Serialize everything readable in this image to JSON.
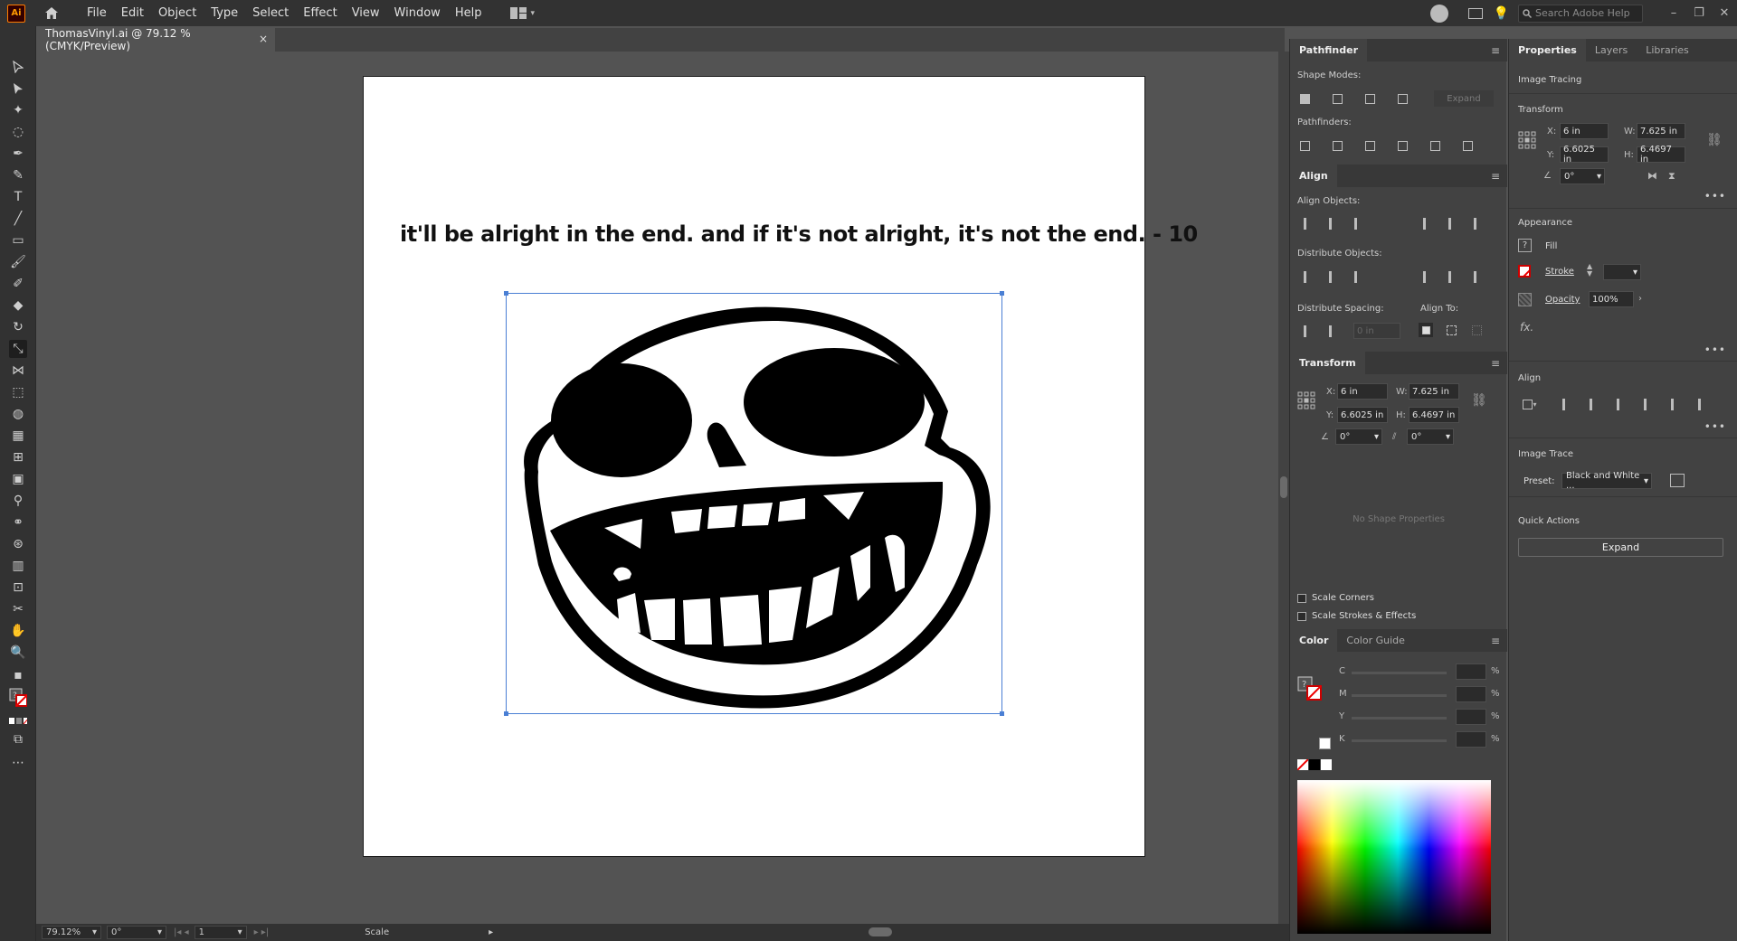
{
  "app": {
    "logo": "Ai"
  },
  "menu": [
    "File",
    "Edit",
    "Object",
    "Type",
    "Select",
    "Effect",
    "View",
    "Window",
    "Help"
  ],
  "search": {
    "placeholder": "Search Adobe Help"
  },
  "document_tab": {
    "title": "ThomasVinyl.ai @ 79.12 % (CMYK/Preview)",
    "close": "×"
  },
  "artboard": {
    "quote": "it'll be alright in the end. and if it's not alright, it's not the end. - 10"
  },
  "statusbar": {
    "zoom": "79.12%",
    "rotation": "0°",
    "artboard_num": "1",
    "tool": "Scale"
  },
  "pathfinder": {
    "tab": "Pathfinder",
    "shape_modes_label": "Shape Modes:",
    "expand_label": "Expand",
    "pathfinders_label": "Pathfinders:"
  },
  "align_panel": {
    "tab": "Align",
    "align_objects_label": "Align Objects:",
    "distribute_objects_label": "Distribute Objects:",
    "distribute_spacing_label": "Distribute Spacing:",
    "align_to_label": "Align To:",
    "spacing_value": "0 in"
  },
  "transform_panel": {
    "tab": "Transform",
    "x_label": "X:",
    "x": "6 in",
    "y_label": "Y:",
    "y": "6.6025 in",
    "w_label": "W:",
    "w": "7.625 in",
    "h_label": "H:",
    "h": "6.4697 in",
    "rotate": "0°",
    "shear": "0°",
    "no_shape": "No Shape Properties",
    "scale_corners": "Scale Corners",
    "scale_strokes": "Scale Strokes & Effects"
  },
  "color_panel": {
    "tab": "Color",
    "tab2": "Color Guide",
    "channels": [
      "C",
      "M",
      "Y",
      "K"
    ],
    "percent": "%"
  },
  "properties": {
    "tabs": [
      "Properties",
      "Layers",
      "Libraries"
    ],
    "image_tracing": "Image Tracing",
    "transform_title": "Transform",
    "x_label": "X:",
    "x": "6 in",
    "y_label": "Y:",
    "y": "6.6025 in",
    "w_label": "W:",
    "w": "7.625 in",
    "h_label": "H:",
    "h": "6.4697 in",
    "rotate": "0°",
    "appearance_title": "Appearance",
    "fill_label": "Fill",
    "stroke_label": "Stroke",
    "opacity_label": "Opacity",
    "opacity": "100%",
    "fx": "fx.",
    "align_title": "Align",
    "image_trace_title": "Image Trace",
    "preset_label": "Preset:",
    "preset_value": "Black and White ...",
    "quick_actions_title": "Quick Actions",
    "expand_button": "Expand"
  },
  "colors": {
    "selection": "#4a7fd4",
    "accent_logo": "#ff9a00"
  }
}
